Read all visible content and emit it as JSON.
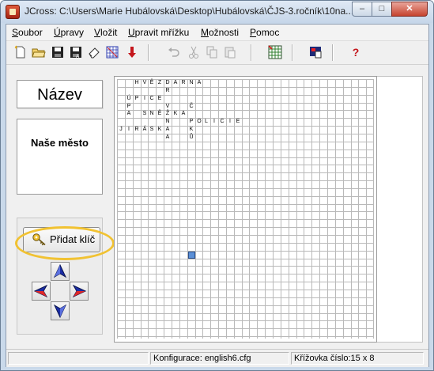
{
  "window": {
    "title": "JCross: C:\\Users\\Marie Hubálovská\\Desktop\\Hubálovská\\ČJS-3.ročník\\10na...",
    "min_label": "–",
    "max_label": "□",
    "close_label": "✕"
  },
  "menu": [
    {
      "label": "Soubor"
    },
    {
      "label": "Úpravy"
    },
    {
      "label": "Vložit"
    },
    {
      "label": "Upravit mřížku"
    },
    {
      "label": "Možnosti"
    },
    {
      "label": "Pomoc"
    }
  ],
  "toolbar": {
    "icons": [
      "new-file-icon",
      "open-folder-icon",
      "save-icon",
      "save-as-icon",
      "eraser-icon",
      "crossword-icon",
      "down-arrow-icon",
      "undo-icon",
      "cut-icon",
      "copy-icon",
      "paste-icon",
      "grid-icon",
      "export-icon",
      "help-icon"
    ],
    "help_label": "?"
  },
  "left_panel": {
    "name_label": "Název",
    "crossword_title": "Naše město",
    "add_key_label": "Přidat klíč",
    "key_icon": "key-icon",
    "arrows": [
      "arrow-up-icon",
      "arrow-left-icon",
      "arrow-right-icon",
      "arrow-down-icon"
    ],
    "highlight_color": "#f1c232"
  },
  "grid": {
    "cols": 33,
    "rows": 33,
    "letters": [
      {
        "r": 0,
        "c": 2,
        "ch": "H"
      },
      {
        "r": 0,
        "c": 3,
        "ch": "V"
      },
      {
        "r": 0,
        "c": 4,
        "ch": "Ě"
      },
      {
        "r": 0,
        "c": 5,
        "ch": "Z"
      },
      {
        "r": 0,
        "c": 6,
        "ch": "D"
      },
      {
        "r": 0,
        "c": 7,
        "ch": "A"
      },
      {
        "r": 0,
        "c": 8,
        "ch": "R"
      },
      {
        "r": 0,
        "c": 9,
        "ch": "N"
      },
      {
        "r": 0,
        "c": 10,
        "ch": "A"
      },
      {
        "r": 1,
        "c": 6,
        "ch": "R"
      },
      {
        "r": 2,
        "c": 1,
        "ch": "Ú"
      },
      {
        "r": 2,
        "c": 2,
        "ch": "P"
      },
      {
        "r": 2,
        "c": 3,
        "ch": "I"
      },
      {
        "r": 2,
        "c": 4,
        "ch": "C"
      },
      {
        "r": 2,
        "c": 5,
        "ch": "E"
      },
      {
        "r": 3,
        "c": 1,
        "ch": "P"
      },
      {
        "r": 3,
        "c": 6,
        "ch": "V"
      },
      {
        "r": 3,
        "c": 9,
        "ch": "Č"
      },
      {
        "r": 4,
        "c": 1,
        "ch": "A"
      },
      {
        "r": 4,
        "c": 3,
        "ch": "S"
      },
      {
        "r": 4,
        "c": 4,
        "ch": "N"
      },
      {
        "r": 4,
        "c": 5,
        "ch": "Ě"
      },
      {
        "r": 4,
        "c": 6,
        "ch": "Ž"
      },
      {
        "r": 4,
        "c": 7,
        "ch": "K"
      },
      {
        "r": 4,
        "c": 8,
        "ch": "A"
      },
      {
        "r": 5,
        "c": 6,
        "ch": "N"
      },
      {
        "r": 5,
        "c": 9,
        "ch": "P"
      },
      {
        "r": 5,
        "c": 10,
        "ch": "O"
      },
      {
        "r": 5,
        "c": 11,
        "ch": "L"
      },
      {
        "r": 5,
        "c": 12,
        "ch": "I"
      },
      {
        "r": 5,
        "c": 13,
        "ch": "C"
      },
      {
        "r": 5,
        "c": 14,
        "ch": "I"
      },
      {
        "r": 5,
        "c": 15,
        "ch": "E"
      },
      {
        "r": 6,
        "c": 0,
        "ch": "J"
      },
      {
        "r": 6,
        "c": 1,
        "ch": "I"
      },
      {
        "r": 6,
        "c": 2,
        "ch": "R"
      },
      {
        "r": 6,
        "c": 3,
        "ch": "Á"
      },
      {
        "r": 6,
        "c": 4,
        "ch": "S"
      },
      {
        "r": 6,
        "c": 5,
        "ch": "K"
      },
      {
        "r": 6,
        "c": 6,
        "ch": "A"
      },
      {
        "r": 6,
        "c": 9,
        "ch": "K"
      },
      {
        "r": 7,
        "c": 6,
        "ch": "A"
      },
      {
        "r": 7,
        "c": 9,
        "ch": "Ů"
      }
    ],
    "cursor": {
      "r": 22,
      "c": 9
    },
    "cursor_color": "#5b8fd6",
    "line_color": "#b9b9b9"
  },
  "status": {
    "pane1": "",
    "config": "Konfigurace: english6.cfg",
    "grid_number": "Křížovka číslo:15 x 8"
  }
}
